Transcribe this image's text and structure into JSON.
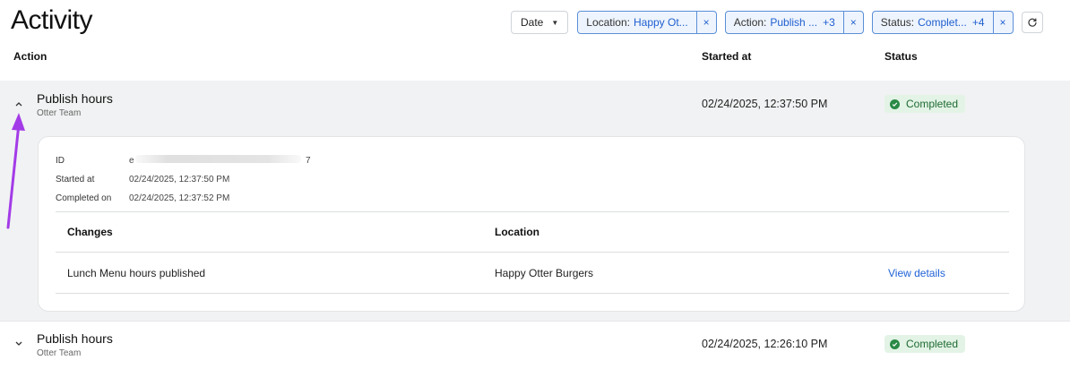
{
  "header": {
    "title": "Activity"
  },
  "filters": {
    "date_label": "Date",
    "chips": [
      {
        "label": "Location:",
        "value": "Happy Ot...",
        "more": ""
      },
      {
        "label": "Action:",
        "value": "Publish ...",
        "more": "+3"
      },
      {
        "label": "Status:",
        "value": "Complet...",
        "more": "+4"
      }
    ],
    "remove_glyph": "×"
  },
  "columns": {
    "action": "Action",
    "started_at": "Started at",
    "status": "Status"
  },
  "rows": [
    {
      "title": "Publish hours",
      "subtitle": "Otter Team",
      "started_at": "02/24/2025, 12:37:50 PM",
      "status": "Completed",
      "expanded": true,
      "details": {
        "id_label": "ID",
        "id_value_start": "e",
        "id_value_end": "7",
        "started_label": "Started at",
        "started_value": "02/24/2025, 12:37:50 PM",
        "completed_label": "Completed on",
        "completed_value": "02/24/2025, 12:37:52 PM",
        "table_headers": {
          "changes": "Changes",
          "location": "Location"
        },
        "table_rows": [
          {
            "change": "Lunch Menu hours published",
            "location": "Happy Otter Burgers",
            "link": "View details"
          }
        ]
      }
    },
    {
      "title": "Publish hours",
      "subtitle": "Otter Team",
      "started_at": "02/24/2025, 12:26:10 PM",
      "status": "Completed",
      "expanded": false
    }
  ],
  "icons": {
    "date_caret": "caret-down-icon",
    "refresh": "refresh-icon",
    "expand_open": "chevron-up-icon",
    "expand_closed": "chevron-down-icon",
    "status_ok": "check-circle-icon"
  },
  "colors": {
    "accent": "#1f62d6",
    "success_bg": "#e3f3e6",
    "success_text": "#1e6b32",
    "annotation": "#a33be8"
  }
}
